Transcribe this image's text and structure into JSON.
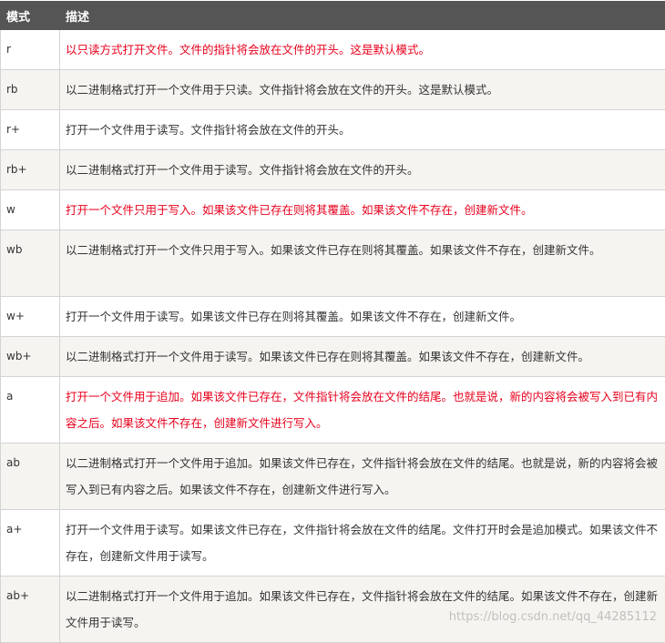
{
  "table": {
    "headers": {
      "mode": "模式",
      "description": "描述"
    },
    "rows": [
      {
        "mode": "r",
        "description": "以只读方式打开文件。文件的指针将会放在文件的开头。这是默认模式。",
        "highlight": "#e8001c"
      },
      {
        "mode": "rb",
        "description": "以二进制格式打开一个文件用于只读。文件指针将会放在文件的开头。这是默认模式。"
      },
      {
        "mode": "r+",
        "description": "打开一个文件用于读写。文件指针将会放在文件的开头。"
      },
      {
        "mode": "rb+",
        "description": "以二进制格式打开一个文件用于读写。文件指针将会放在文件的开头。"
      },
      {
        "mode": "w",
        "description": "打开一个文件只用于写入。如果该文件已存在则将其覆盖。如果该文件不存在，创建新文件。",
        "highlight": "#e8001c"
      },
      {
        "mode": "wb",
        "description": "以二进制格式打开一个文件只用于写入。如果该文件已存在则将其覆盖。如果该文件不存在，创建新文件。"
      },
      {
        "mode": "w+",
        "description": "打开一个文件用于读写。如果该文件已存在则将其覆盖。如果该文件不存在，创建新文件。"
      },
      {
        "mode": "wb+",
        "description": "以二进制格式打开一个文件用于读写。如果该文件已存在则将其覆盖。如果该文件不存在，创建新文件。"
      },
      {
        "mode": "a",
        "description": "打开一个文件用于追加。如果该文件已存在，文件指针将会放在文件的结尾。也就是说，新的内容将会被写入到已有内容之后。如果该文件不存在，创建新文件进行写入。",
        "highlight": "#e8001c"
      },
      {
        "mode": "ab",
        "description": "以二进制格式打开一个文件用于追加。如果该文件已存在，文件指针将会放在文件的结尾。也就是说，新的内容将会被写入到已有内容之后。如果该文件不存在，创建新文件进行写入。"
      },
      {
        "mode": "a+",
        "description": "打开一个文件用于读写。如果该文件已存在，文件指针将会放在文件的结尾。文件打开时会是追加模式。如果该文件不存在，创建新文件用于读写。"
      },
      {
        "mode": "ab+",
        "description": "以二进制格式打开一个文件用于追加。如果该文件已存在，文件指针将会放在文件的结尾。如果该文件不存在，创建新文件用于读写。"
      }
    ]
  },
  "watermark": "https://blog.csdn.net/qq_44285112"
}
